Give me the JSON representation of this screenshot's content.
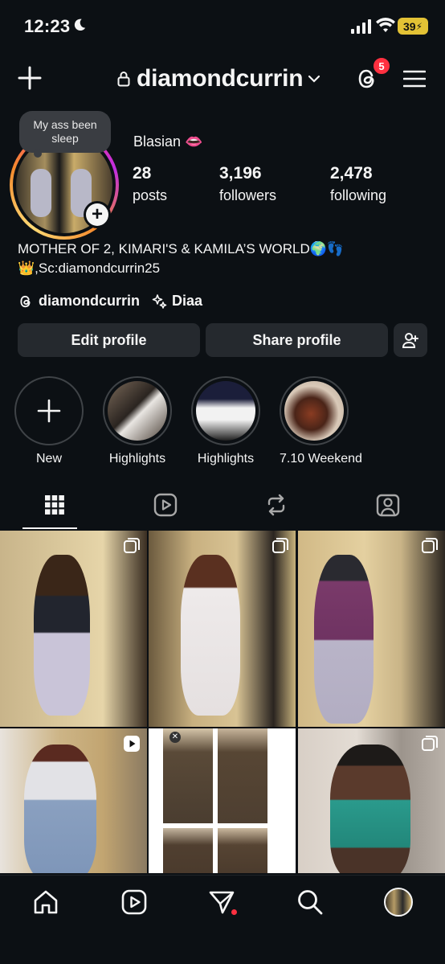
{
  "status_bar": {
    "time": "12:23",
    "battery": "39"
  },
  "header": {
    "username": "diamondcurrin",
    "notification_count": "5"
  },
  "profile": {
    "note": "My ass been sleep",
    "display_name": "Blasian 👄",
    "stats": [
      {
        "value": "28",
        "label": "posts"
      },
      {
        "value": "3,196",
        "label": "followers"
      },
      {
        "value": "2,478",
        "label": "following"
      }
    ],
    "bio_line1": "MOTHER OF 2, KIMARI'S & KAMILA’S WORLD🌍👣",
    "bio_line2": "👑,Sc:diamondcurrin25",
    "threads_link": "diamondcurrin",
    "extra_link": "Diaa"
  },
  "actions": {
    "edit": "Edit profile",
    "share": "Share profile"
  },
  "highlights": [
    {
      "label": "New"
    },
    {
      "label": "Highlights"
    },
    {
      "label": "Highlights"
    },
    {
      "label": "7.10 Weekend"
    }
  ],
  "tabs": [
    "grid-icon",
    "reels-icon",
    "reposts-icon",
    "tagged-icon"
  ],
  "posts_count_visible": 6,
  "colors": {
    "background": "#0c1014",
    "button": "#25292e",
    "badge": "#ff3040"
  }
}
